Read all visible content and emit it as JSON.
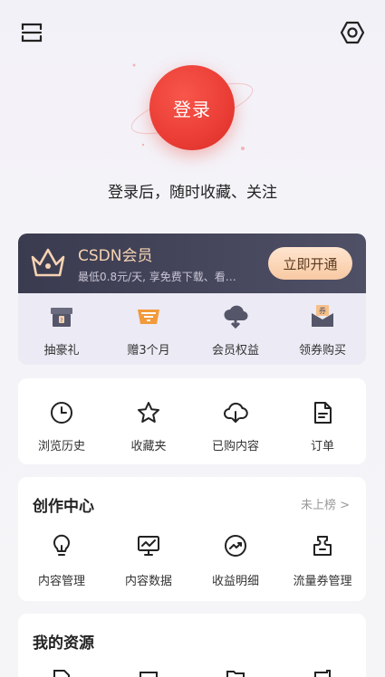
{
  "header": {
    "menu_icon": "menu-icon",
    "settings_icon": "hexagon-settings-icon"
  },
  "login": {
    "button_label": "登录",
    "tip": "登录后，随时收藏、关注"
  },
  "vip": {
    "title": "CSDN会员",
    "subtitle": "最低0.8元/天, 享免费下载、看…",
    "open_button": "立即开通",
    "items": [
      {
        "label": "抽豪礼",
        "icon": "gift-box-icon"
      },
      {
        "label": "赠3个月",
        "icon": "gift-badge-icon"
      },
      {
        "label": "会员权益",
        "icon": "cloud-download-icon"
      },
      {
        "label": "领券购买",
        "icon": "coupon-icon"
      }
    ],
    "colors": {
      "title": "#f6d3b3",
      "button": "#f8c9a3",
      "head_bg": "#3a3b4f"
    }
  },
  "quick": {
    "items": [
      {
        "label": "浏览历史",
        "icon": "clock-icon"
      },
      {
        "label": "收藏夹",
        "icon": "star-icon"
      },
      {
        "label": "已购内容",
        "icon": "cloud-download-icon"
      },
      {
        "label": "订单",
        "icon": "document-icon"
      }
    ]
  },
  "create": {
    "title": "创作中心",
    "link": "未上榜 >",
    "items": [
      {
        "label": "内容管理",
        "icon": "bulb-icon"
      },
      {
        "label": "内容数据",
        "icon": "chart-monitor-icon"
      },
      {
        "label": "收益明细",
        "icon": "trend-circle-icon"
      },
      {
        "label": "流量券管理",
        "icon": "ticket-icon"
      }
    ]
  },
  "resources": {
    "title": "我的资源"
  },
  "colors": {
    "accent": "#ea3d35"
  }
}
